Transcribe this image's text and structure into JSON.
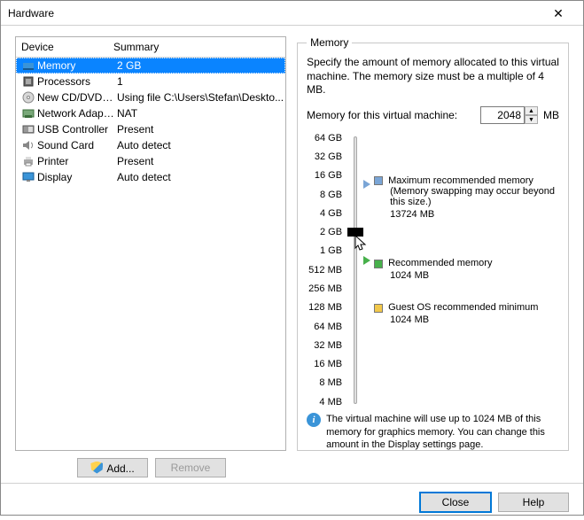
{
  "title": "Hardware",
  "deviceTable": {
    "headers": {
      "device": "Device",
      "summary": "Summary"
    },
    "rows": [
      {
        "name": "Memory",
        "summary": "2 GB",
        "icon": "memory"
      },
      {
        "name": "Processors",
        "summary": "1",
        "icon": "cpu"
      },
      {
        "name": "New CD/DVD (...",
        "summary": "Using file C:\\Users\\Stefan\\Deskto...",
        "icon": "cd"
      },
      {
        "name": "Network Adapter",
        "summary": "NAT",
        "icon": "nic"
      },
      {
        "name": "USB Controller",
        "summary": "Present",
        "icon": "usb"
      },
      {
        "name": "Sound Card",
        "summary": "Auto detect",
        "icon": "sound"
      },
      {
        "name": "Printer",
        "summary": "Present",
        "icon": "printer"
      },
      {
        "name": "Display",
        "summary": "Auto detect",
        "icon": "display"
      }
    ],
    "selectedIndex": 0
  },
  "memory": {
    "legend": "Memory",
    "description": "Specify the amount of memory allocated to this virtual machine. The memory size must be a multiple of 4 MB.",
    "inputLabel": "Memory for this virtual machine:",
    "valueMB": "2048",
    "unit": "MB",
    "ticks": [
      "64 GB",
      "32 GB",
      "16 GB",
      "8 GB",
      "4 GB",
      "2 GB",
      "1 GB",
      "512 MB",
      "256 MB",
      "128 MB",
      "64 MB",
      "32 MB",
      "16 MB",
      "8 MB",
      "4 MB"
    ],
    "selectedTickIndex": 5,
    "markers": {
      "max": {
        "tickIndex": 2,
        "color": "#7aa5d6",
        "side": "right",
        "title": "Maximum recommended memory",
        "subtitle": "(Memory swapping may occur beyond this size.)",
        "value": "13724 MB"
      },
      "rec": {
        "tickIndex": 6,
        "color": "#47b04b",
        "side": "right",
        "title": "Recommended memory",
        "value": "1024 MB"
      },
      "min": {
        "tickIndex": 6,
        "color": "#f2c84b",
        "side": "right",
        "title": "Guest OS recommended minimum",
        "value": "1024 MB"
      }
    },
    "note": "The virtual machine will use up to 1024 MB of this memory for graphics memory. You can change this amount in the Display settings page."
  },
  "buttons": {
    "add": "Add...",
    "remove": "Remove",
    "close": "Close",
    "help": "Help"
  }
}
